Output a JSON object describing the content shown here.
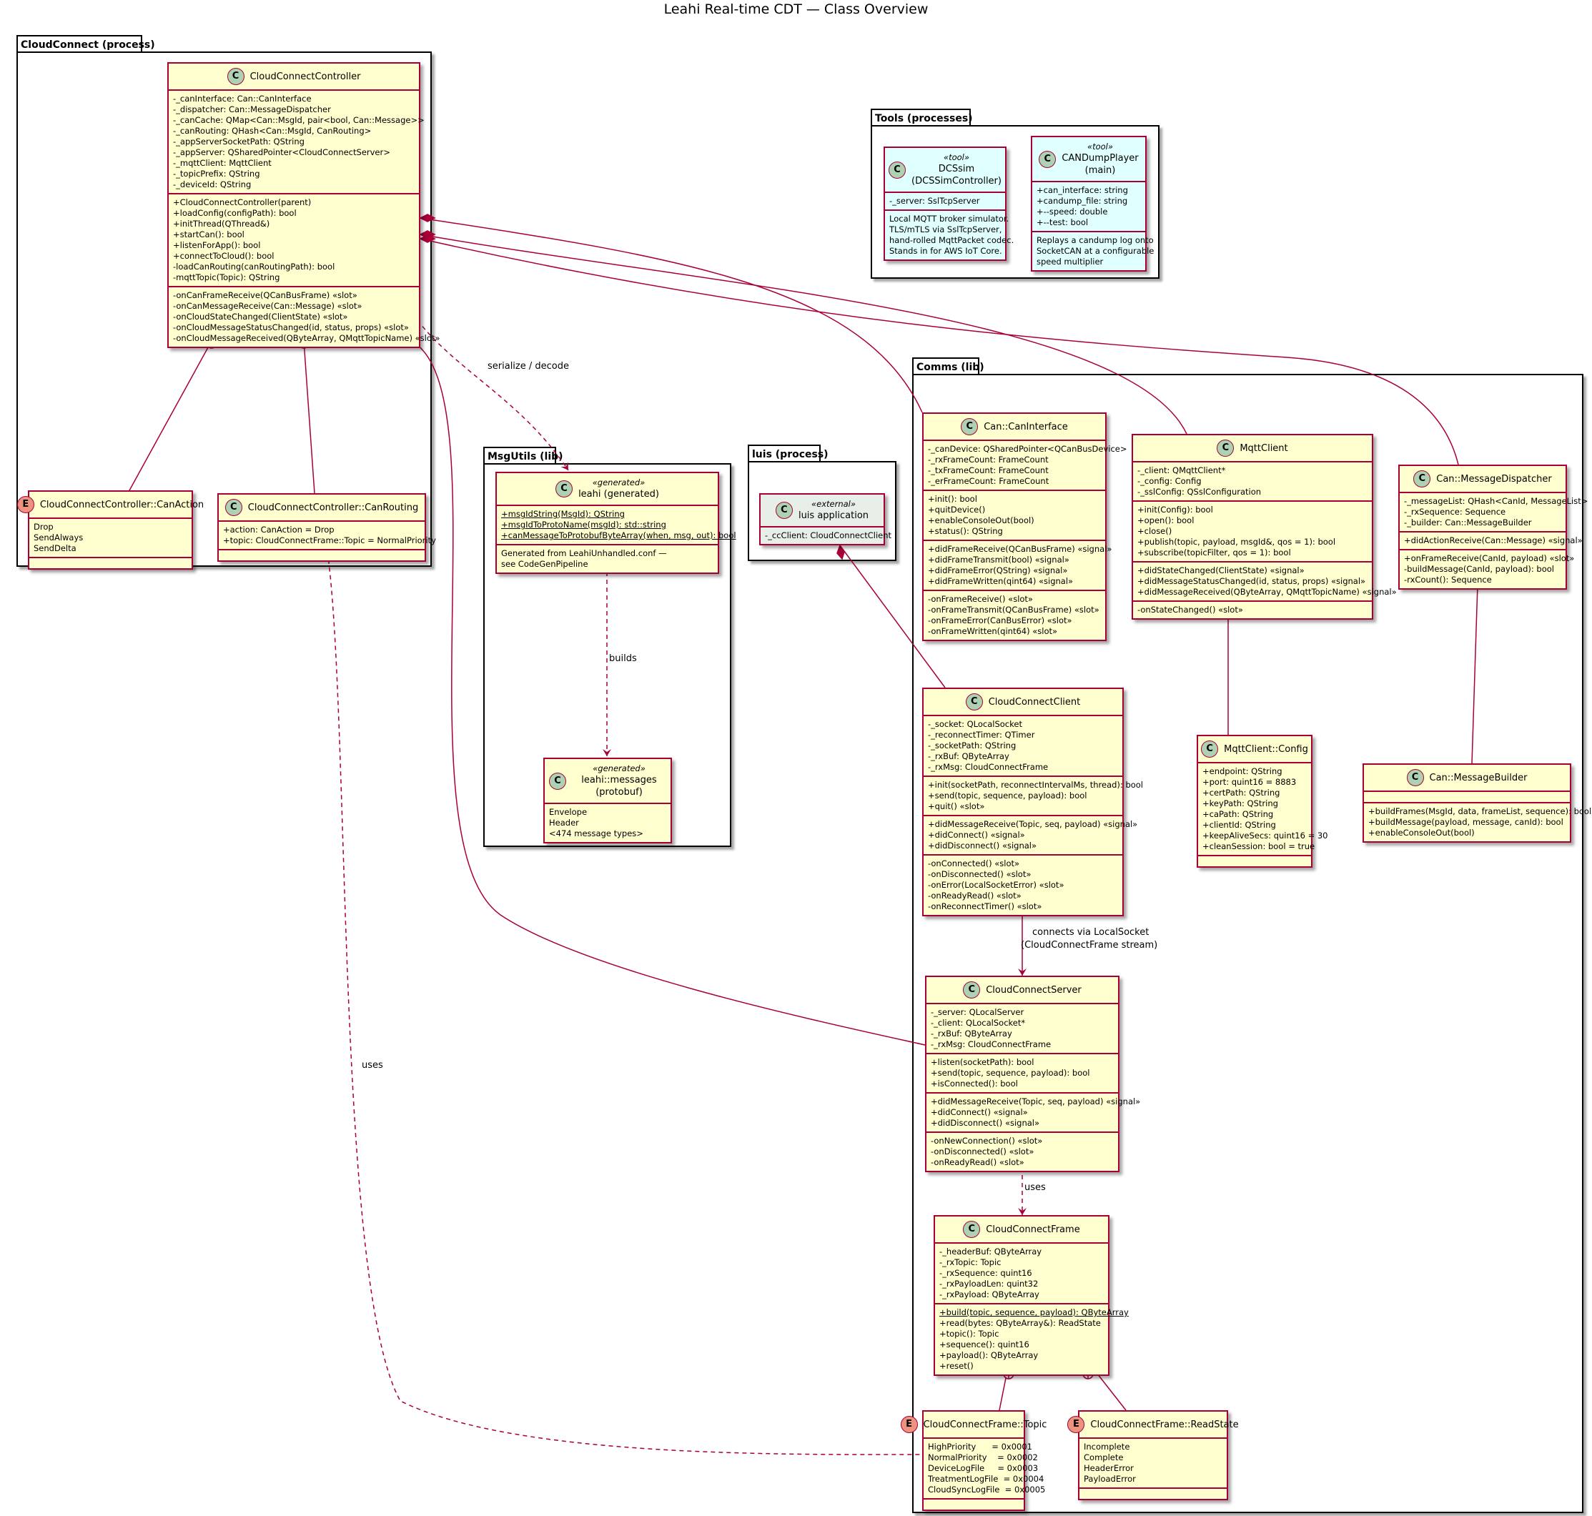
{
  "title": "Leahi Real-time CDT — Class Overview",
  "colors": {
    "border": "#a80036",
    "class_fill": "#fefece",
    "tool_fill": "#e0ffff",
    "external_fill": "#e8efe8",
    "class_badge": "#add1b2",
    "enum_badge": "#eb937f"
  },
  "packages": {
    "cloudconnect": "CloudConnect (process)",
    "tools": "Tools (processes)",
    "msgutils": "MsgUtils (lib)",
    "luis": "luis (process)",
    "comms": "Comms (lib)"
  },
  "classes": {
    "controller": {
      "name": "CloudConnectController",
      "attrs": [
        "-_canInterface: Can::CanInterface",
        "-_dispatcher: Can::MessageDispatcher",
        "-_canCache: QMap<Can::MsgId, pair<bool, Can::Message>>",
        "-_canRouting: QHash<Can::MsgId, CanRouting>",
        "-_appServerSocketPath: QString",
        "-_appServer: QSharedPointer<CloudConnectServer>",
        "-_mqttClient: MqttClient",
        "-_topicPrefix: QString",
        "-_deviceId: QString"
      ],
      "methods": [
        "+CloudConnectController(parent)",
        "+loadConfig(configPath): bool",
        "+initThread(QThread&)",
        "+startCan(): bool",
        "+listenForApp(): bool",
        "+connectToCloud(): bool",
        "-loadCanRouting(canRoutingPath): bool",
        "-mqttTopic(Topic): QString"
      ],
      "slots": [
        "-onCanFrameReceive(QCanBusFrame) «slot»",
        "-onCanMessageReceive(Can::Message) «slot»",
        "-onCloudStateChanged(ClientState) «slot»",
        "-onCloudMessageStatusChanged(id, status, props) «slot»",
        "-onCloudMessageReceived(QByteArray, QMqttTopicName) «slot»"
      ]
    },
    "canaction": {
      "name": "CloudConnectController::CanAction",
      "values": [
        "Drop",
        "SendAlways",
        "SendDelta"
      ]
    },
    "canrouting": {
      "name": "CloudConnectController::CanRouting",
      "attrs": [
        "+action: CanAction = Drop",
        "+topic: CloudConnectFrame::Topic = NormalPriority"
      ]
    },
    "dcssim": {
      "stereotype": "«tool»",
      "name_line1": "DCSsim",
      "name_line2": "(DCSSimController)",
      "attrs": [
        "-_server: SslTcpServer"
      ],
      "notes": [
        "Local MQTT broker simulator.",
        "TLS/mTLS via SslTcpServer,",
        "hand-rolled MqttPacket codec.",
        "Stands in for AWS IoT Core."
      ]
    },
    "candump": {
      "stereotype": "«tool»",
      "name_line1": "CANDumpPlayer",
      "name_line2": "(main)",
      "attrs": [
        "+can_interface: string",
        "+candump_file: string",
        "+--speed: double",
        "+--test: bool"
      ],
      "notes": [
        "Replays a candump log onto",
        "SocketCAN at a configurable",
        "speed multiplier"
      ]
    },
    "leahigen": {
      "stereotype": "«generated»",
      "name": "leahi (generated)",
      "methods": [
        "+msgIdString(MsgId): QString",
        "+msgIdToProtoName(msgId): std::string",
        "+canMessageToProtobufByteArray(when, msg, out): bool"
      ],
      "notes": [
        "Generated from LeahiUnhandled.conf —",
        "see CodeGenPipeline"
      ]
    },
    "leahimsgs": {
      "stereotype": "«generated»",
      "name": "leahi::messages (protobuf)",
      "items": [
        "Envelope",
        "Header",
        "<474 message types>"
      ]
    },
    "luisapp": {
      "stereotype": "«external»",
      "name": "luis application",
      "attrs": [
        "-_ccClient: CloudConnectClient"
      ]
    },
    "caninterface": {
      "name": "Can::CanInterface",
      "attrs": [
        "-_canDevice: QSharedPointer<QCanBusDevice>",
        "-_rxFrameCount: FrameCount",
        "-_txFrameCount: FrameCount",
        "-_erFrameCount: FrameCount"
      ],
      "methods": [
        "+init(): bool",
        "+quitDevice()",
        "+enableConsoleOut(bool)",
        "+status(): QString"
      ],
      "signals": [
        "+didFrameReceive(QCanBusFrame) «signal»",
        "+didFrameTransmit(bool) «signal»",
        "+didFrameError(QString) «signal»",
        "+didFrameWritten(qint64) «signal»"
      ],
      "slots": [
        "-onFrameReceive() «slot»",
        "-onFrameTransmit(QCanBusFrame) «slot»",
        "-onFrameError(CanBusError) «slot»",
        "-onFrameWritten(qint64) «slot»"
      ]
    },
    "mqttclient": {
      "name": "MqttClient",
      "attrs": [
        "-_client: QMqttClient*",
        "-_config: Config",
        "-_sslConfig: QSslConfiguration"
      ],
      "methods": [
        "+init(Config): bool",
        "+open(): bool",
        "+close()",
        "+publish(topic, payload, msgId&, qos = 1): bool",
        "+subscribe(topicFilter, qos = 1): bool"
      ],
      "signals": [
        "+didStateChanged(ClientState) «signal»",
        "+didMessageStatusChanged(id, status, props) «signal»",
        "+didMessageReceived(QByteArray, QMqttTopicName) «signal»"
      ],
      "slots": [
        "-onStateChanged() «slot»"
      ]
    },
    "dispatcher": {
      "name": "Can::MessageDispatcher",
      "attrs": [
        "-_messageList: QHash<CanId, MessageList>",
        "-_rxSequence: Sequence",
        "-_builder: Can::MessageBuilder"
      ],
      "signals": [
        "+didActionReceive(Can::Message) «signal»"
      ],
      "methods": [
        "+onFrameReceive(CanId, payload) «slot»",
        "-buildMessage(CanId, payload): bool",
        "-rxCount(): Sequence"
      ]
    },
    "ccclient": {
      "name": "CloudConnectClient",
      "attrs": [
        "-_socket: QLocalSocket",
        "-_reconnectTimer: QTimer",
        "-_socketPath: QString",
        "-_rxBuf: QByteArray",
        "-_rxMsg: CloudConnectFrame"
      ],
      "methods": [
        "+init(socketPath, reconnectIntervalMs, thread): bool",
        "+send(topic, sequence, payload): bool",
        "+quit() «slot»"
      ],
      "signals": [
        "+didMessageReceive(Topic, seq, payload) «signal»",
        "+didConnect() «signal»",
        "+didDisconnect() «signal»"
      ],
      "slots": [
        "-onConnected() «slot»",
        "-onDisconnected() «slot»",
        "-onError(LocalSocketError) «slot»",
        "-onReadyRead() «slot»",
        "-onReconnectTimer() «slot»"
      ]
    },
    "mqttconfig": {
      "name": "MqttClient::Config",
      "attrs": [
        "+endpoint: QString",
        "+port: quint16 = 8883",
        "+certPath: QString",
        "+keyPath: QString",
        "+caPath: QString",
        "+clientId: QString",
        "+keepAliveSecs: quint16 = 30",
        "+cleanSession: bool = true"
      ]
    },
    "builder": {
      "name": "Can::MessageBuilder",
      "methods": [
        "+buildFrames(MsgId, data, frameList, sequence): bool",
        "+buildMessage(payload, message, canId): bool",
        "+enableConsoleOut(bool)"
      ]
    },
    "ccserver": {
      "name": "CloudConnectServer",
      "attrs": [
        "-_server: QLocalServer",
        "-_client: QLocalSocket*",
        "-_rxBuf: QByteArray",
        "-_rxMsg: CloudConnectFrame"
      ],
      "methods": [
        "+listen(socketPath): bool",
        "+send(topic, sequence, payload): bool",
        "+isConnected(): bool"
      ],
      "signals": [
        "+didMessageReceive(Topic, seq, payload) «signal»",
        "+didConnect() «signal»",
        "+didDisconnect() «signal»"
      ],
      "slots": [
        "-onNewConnection() «slot»",
        "-onDisconnected() «slot»",
        "-onReadyRead() «slot»"
      ]
    },
    "ccframe": {
      "name": "CloudConnectFrame",
      "attrs": [
        "-_headerBuf: QByteArray",
        "-_rxTopic: Topic",
        "-_rxSequence: quint16",
        "-_rxPayloadLen: quint32",
        "-_rxPayload: QByteArray"
      ],
      "methods": [
        "+build(topic, sequence, payload): QByteArray",
        "+read(bytes: QByteArray&): ReadState",
        "+topic(): Topic",
        "+sequence(): quint16",
        "+payload(): QByteArray",
        "+reset()"
      ]
    },
    "topic": {
      "name": "CloudConnectFrame::Topic",
      "values": [
        "HighPriority      = 0x0001",
        "NormalPriority    = 0x0002",
        "DeviceLogFile     = 0x0003",
        "TreatmentLogFile  = 0x0004",
        "CloudSyncLogFile  = 0x0005"
      ]
    },
    "readstate": {
      "name": "CloudConnectFrame::ReadState",
      "values": [
        "Incomplete",
        "Complete",
        "HeaderError",
        "PayloadError"
      ]
    }
  },
  "edge_labels": {
    "serialize": "serialize / decode",
    "builds": "builds",
    "connects_line1": "connects via LocalSocket",
    "connects_line2": "(CloudConnectFrame stream)",
    "uses_frame": "uses",
    "uses_topic": "uses"
  }
}
